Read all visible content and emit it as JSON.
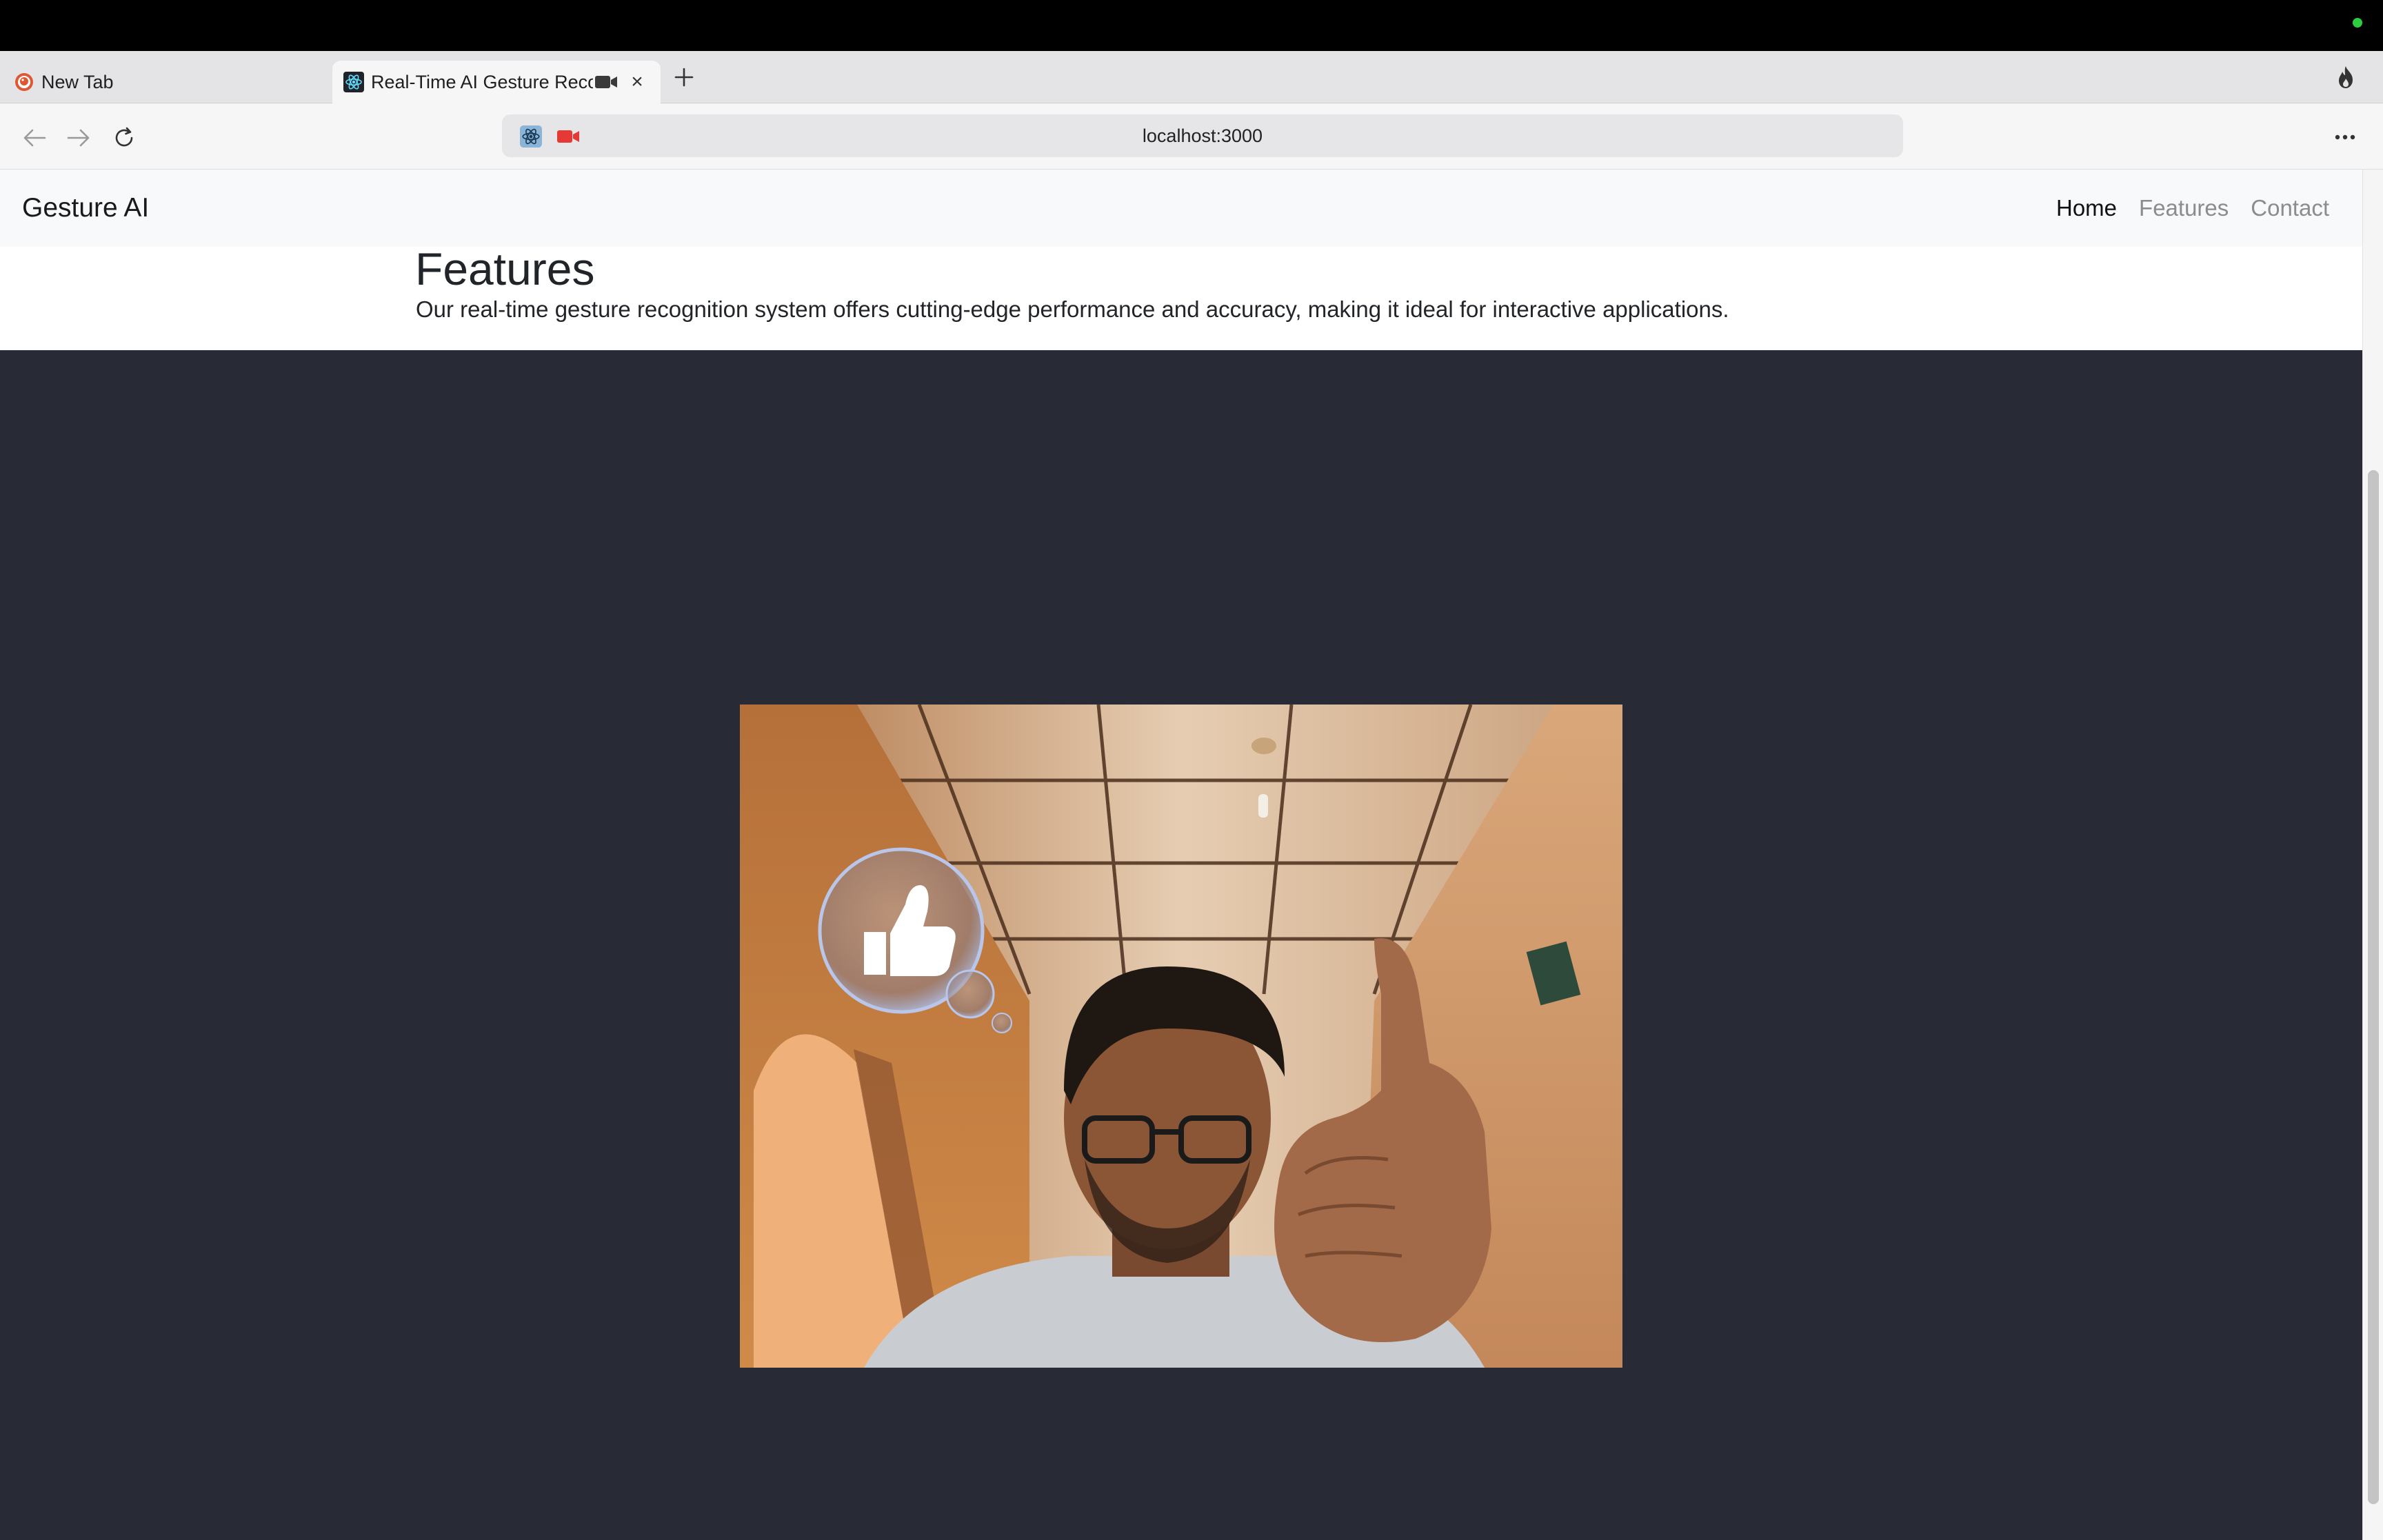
{
  "browser": {
    "tabs": [
      {
        "label": "New Tab",
        "icon": "duckduckgo-icon"
      },
      {
        "label": "Real-Time AI Gesture Recognition",
        "icon": "react-icon",
        "active": true,
        "recording": true
      }
    ],
    "address": "localhost:3000",
    "accent_recording": "#e53935"
  },
  "navbar": {
    "brand": "Gesture AI",
    "links": [
      {
        "label": "Home",
        "active": true
      },
      {
        "label": "Features",
        "active": false
      },
      {
        "label": "Contact",
        "active": false
      }
    ]
  },
  "features": {
    "title": "Features",
    "description": "Our real-time gesture recognition system offers cutting-edge performance and accuracy, making it ideal for interactive applications."
  },
  "webcam": {
    "detected_gesture_icon": "thumbs-up-icon"
  },
  "colors": {
    "dark_background": "#282b35",
    "navbar_background": "#f8f9fa"
  }
}
